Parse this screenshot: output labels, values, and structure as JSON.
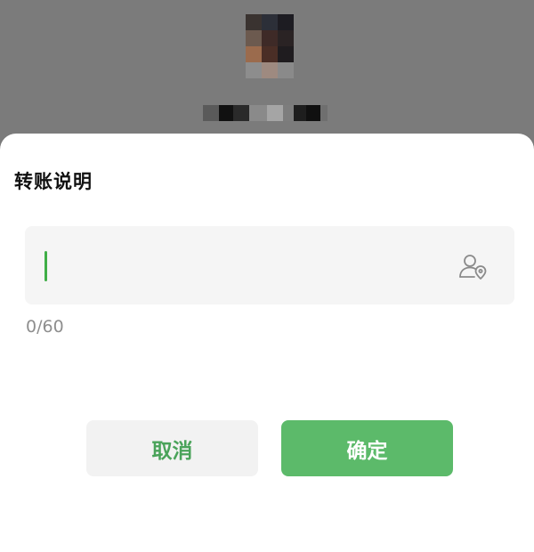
{
  "sheet": {
    "title": "转账说明"
  },
  "memo_input": {
    "value": "",
    "counter": "0/60",
    "icon": "contact-pin-icon"
  },
  "buttons": {
    "cancel_label": "取消",
    "confirm_label": "确定"
  },
  "colors": {
    "accent_green": "#5cba6a",
    "cursor_green": "#3fae47",
    "cancel_text_green": "#4aa35a",
    "backdrop_gray": "#7b7b7b"
  }
}
